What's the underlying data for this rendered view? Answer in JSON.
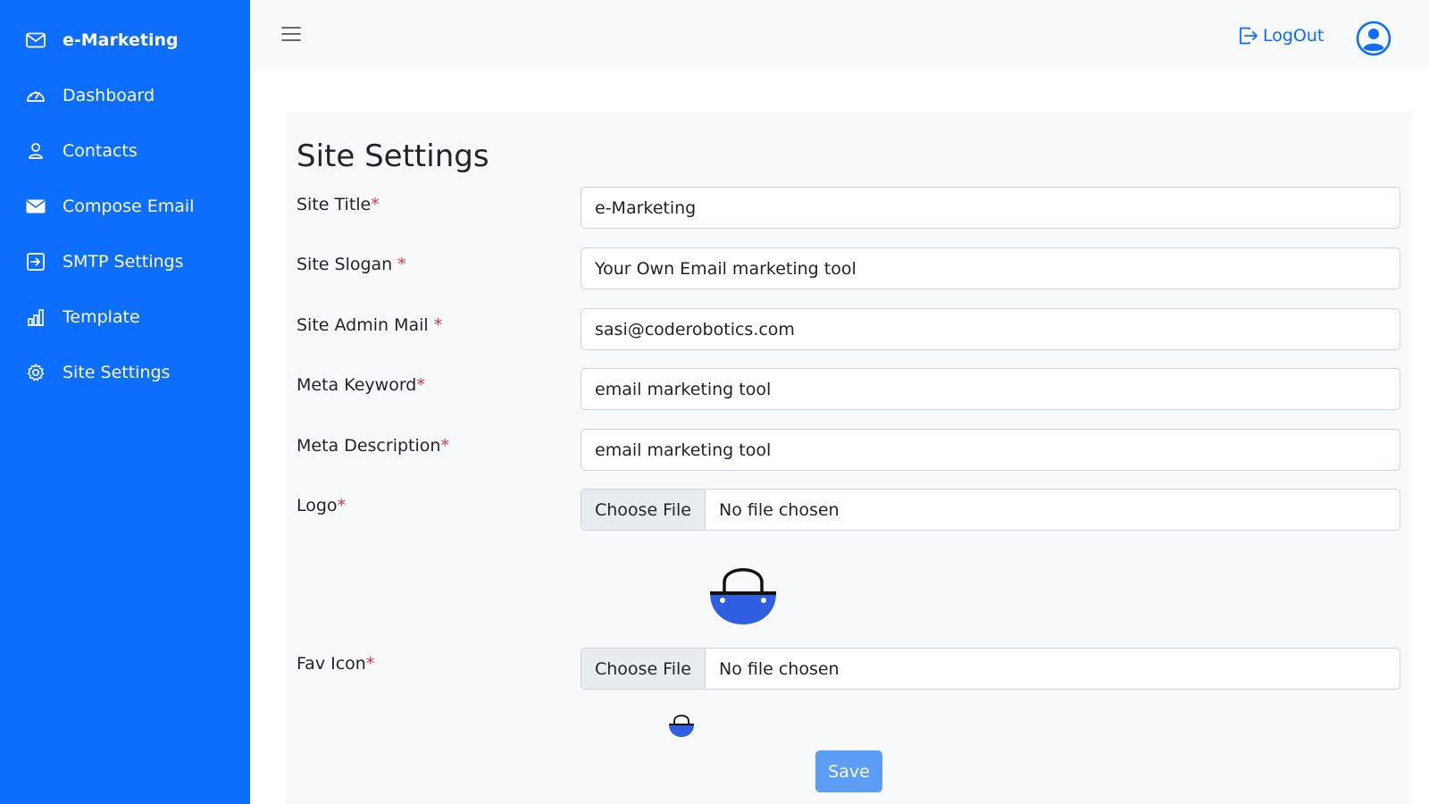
{
  "sidebar": {
    "brand": {
      "label": "e-Marketing",
      "icon": "envelope-icon"
    },
    "items": [
      {
        "label": "Dashboard",
        "icon": "speedometer-icon"
      },
      {
        "label": "Contacts",
        "icon": "person-icon"
      },
      {
        "label": "Compose Email",
        "icon": "envelope-filled-icon"
      },
      {
        "label": "SMTP Settings",
        "icon": "box-arrow-in-right-icon"
      },
      {
        "label": "Template",
        "icon": "building-chart-icon"
      },
      {
        "label": "Site Settings",
        "icon": "gear-icon"
      }
    ]
  },
  "topbar": {
    "menu_icon": "hamburger-icon",
    "logout_label": "LogOut",
    "avatar_icon": "user-circle-icon"
  },
  "page": {
    "title": "Site Settings",
    "required_mark": "*",
    "fields": {
      "site_title": {
        "label": "Site Title",
        "value": "e-Marketing"
      },
      "site_slogan": {
        "label": "Site Slogan ",
        "value": "Your Own Email marketing tool"
      },
      "site_admin_mail": {
        "label": "Site Admin Mail ",
        "value": "sasi@coderobotics.com"
      },
      "meta_keyword": {
        "label": "Meta Keyword",
        "value": "email marketing tool"
      },
      "meta_description": {
        "label": "Meta Description",
        "value": "email marketing tool"
      }
    },
    "logo": {
      "label": "Logo",
      "button": "Choose File",
      "status": "No file chosen"
    },
    "favicon": {
      "label": "Fav Icon",
      "button": "Choose File",
      "status": "No file chosen"
    },
    "save_label": "Save"
  },
  "colors": {
    "primary": "#0d6efd",
    "required": "#dc3545",
    "save_button": "#5c9df5",
    "logo_blue": "#2f5ee0"
  }
}
